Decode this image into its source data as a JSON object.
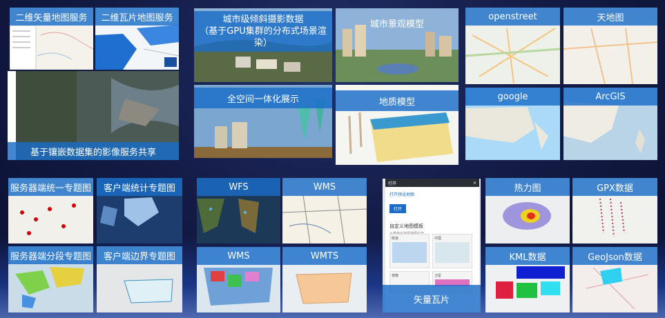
{
  "tiles": {
    "vector_map": "二维矢量地图服务",
    "tile_map": "二维瓦片地图服务",
    "mosaic": "基于镶嵌数据集的影像服务共享",
    "oblique_line1": "城市级倾斜摄影数据",
    "oblique_line2": "（基于GPU集群的分布式场景渲染）",
    "city_model": "城市景观模型",
    "fullspace": "全空间一体化展示",
    "geology": "地质模型",
    "openstreet": "openstreet",
    "tianditu": "天地图",
    "google": "google",
    "arcgis": "ArcGIS",
    "server_thematic": "服务器端统一专题图",
    "client_stat": "客户端统计专题图",
    "server_segment": "服务器端分段专题图",
    "client_boundary": "客户端边界专题图",
    "wfs": "WFS",
    "wms_1": "WMS",
    "wms_2": "WMS",
    "wmts": "WMTS",
    "vector_tile": "矢量瓦片",
    "heatmap": "热力图",
    "gpx": "GPX数据",
    "kml": "KML数据",
    "geojson": "GeoJson数据"
  },
  "dialog": {
    "title": "打开",
    "close": "×",
    "link": "打开预设地图",
    "open_button": "打开",
    "custom_title": "自定义地图模板",
    "custom_sub": "从模板中选择地图打开",
    "card1": "街道",
    "card2": "中国",
    "card3": "夜晚",
    "card4": "卫星"
  }
}
